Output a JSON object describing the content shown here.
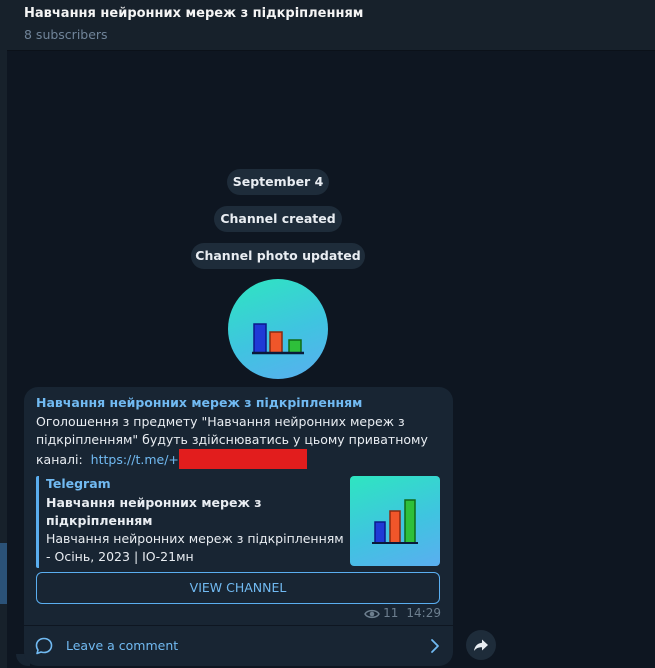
{
  "header": {
    "title": "Навчання нейронних мереж з підкріпленням",
    "subtitle": "8 subscribers"
  },
  "service": {
    "date": "September 4",
    "created": "Channel created",
    "photo_updated": "Channel photo updated"
  },
  "post": {
    "author": "Навчання нейронних мереж з підкріпленням",
    "text": "Оголошення з предмету \"Навчання нейронних мереж з підкріпленням\" будуть здійснюватись у цьому приватному каналі:",
    "link": "https://t.me/+",
    "preview": {
      "site": "Telegram",
      "title": "Навчання нейронних мереж з підкріпленням",
      "description": "Навчання нейронних мереж з підкріпленням - Осінь, 2023 | ІО-21мн"
    },
    "button_label": "VIEW CHANNEL",
    "views": "11",
    "time": "14:29",
    "comment_label": "Leave a comment"
  },
  "colors": {
    "accent": "#71baf2",
    "redaction": "#e21d1d",
    "bar_blue": "#1f3ad6",
    "bar_orange": "#f0562a",
    "bar_green": "#2ec03a"
  }
}
